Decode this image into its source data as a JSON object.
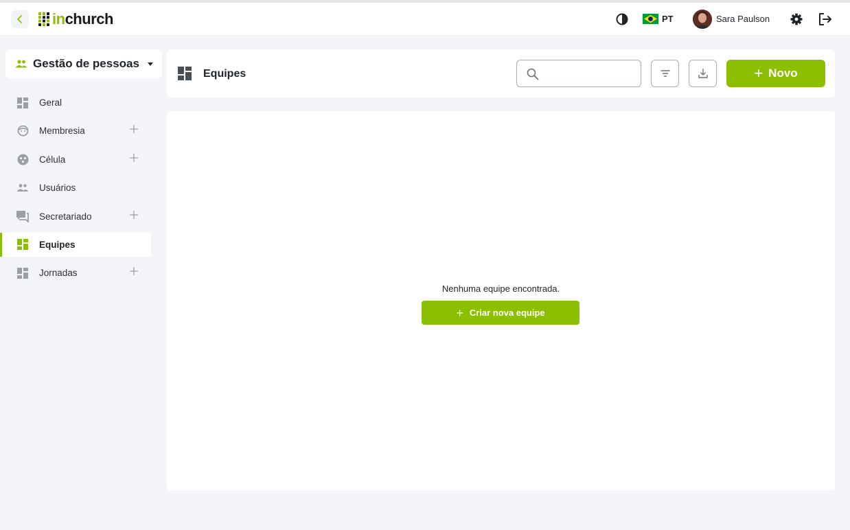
{
  "app": {
    "logo_in": "in",
    "logo_church": "church",
    "accent_color": "#8bbf00"
  },
  "header": {
    "language": "PT",
    "user_name": "Sara Paulson",
    "icons": {
      "back": "chevron-left-icon",
      "contrast": "contrast-icon",
      "flag": "brazil-flag-icon",
      "settings": "gear-icon",
      "logout": "logout-icon"
    }
  },
  "sidebar": {
    "module_title": "Gestão de pessoas",
    "items": [
      {
        "label": "Geral",
        "icon": "dashboard-icon",
        "has_add": false,
        "active": false
      },
      {
        "label": "Membresia",
        "icon": "face-icon",
        "has_add": true,
        "active": false
      },
      {
        "label": "Célula",
        "icon": "cell-icon",
        "has_add": true,
        "active": false
      },
      {
        "label": "Usuários",
        "icon": "users-icon",
        "has_add": false,
        "active": false
      },
      {
        "label": "Secretariado",
        "icon": "chat-icon",
        "has_add": true,
        "active": false
      },
      {
        "label": "Equipes",
        "icon": "dashboard-icon",
        "has_add": false,
        "active": true
      },
      {
        "label": "Jornadas",
        "icon": "dashboard-icon",
        "has_add": true,
        "active": false
      }
    ]
  },
  "page": {
    "title": "Equipes",
    "search_value": "",
    "new_button_label": "Novo",
    "empty_message": "Nenhuma equipe encontrada.",
    "create_button_label": "Criar nova equipe"
  }
}
